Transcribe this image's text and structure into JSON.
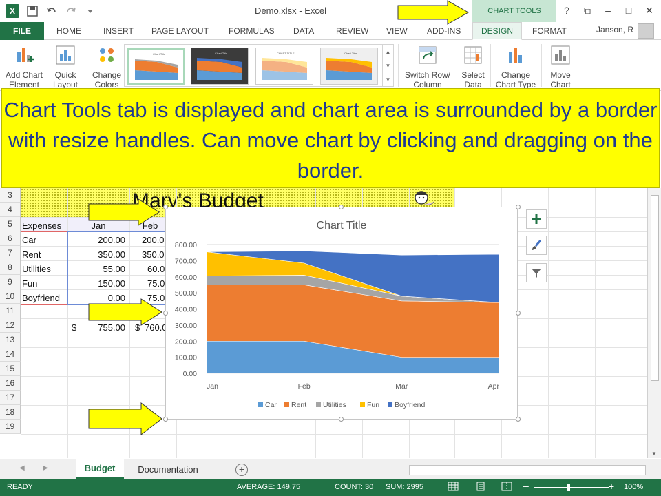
{
  "titlebar": {
    "app_icon": "X",
    "doc_title": "Demo.xlsx - Excel",
    "context_group": "CHART TOOLS",
    "window_controls": [
      "?",
      "⧉",
      "–",
      "□",
      "✕"
    ]
  },
  "tabs": {
    "file": "FILE",
    "home": "HOME",
    "insert": "INSERT",
    "page_layout": "PAGE LAYOUT",
    "formulas": "FORMULAS",
    "data": "DATA",
    "review": "REVIEW",
    "view": "VIEW",
    "addins": "ADD-INS",
    "design": "DESIGN",
    "format": "FORMAT",
    "user": "Janson, R"
  },
  "ribbon": {
    "add_chart_element": "Add Chart Element",
    "quick_layout": "Quick Layout",
    "change_colors": "Change Colors",
    "switch_row_column": "Switch Row/ Column",
    "select_data": "Select Data",
    "change_chart_type": "Change Chart Type",
    "move_chart": "Move Chart",
    "style_thumbs": [
      "Chart Title",
      "Chart Title",
      "CHART TITLE",
      "Chart Title"
    ]
  },
  "callout": {
    "text": "Chart Tools tab is displayed and chart area is surrounded by a border with resize handles.  Can move chart by clicking and dragging on the border."
  },
  "sheet": {
    "row_numbers": [
      "3",
      "4",
      "5",
      "6",
      "7",
      "8",
      "9",
      "10",
      "11",
      "12",
      "13",
      "14",
      "15",
      "16",
      "17",
      "18",
      "19"
    ],
    "title": "Mary's Budget",
    "header": {
      "expenses": "Expenses",
      "jan": "Jan",
      "feb": "Feb"
    },
    "rows": [
      {
        "label": "Car",
        "jan": "200.00",
        "feb": "200.0"
      },
      {
        "label": "Rent",
        "jan": "350.00",
        "feb": "350.0"
      },
      {
        "label": "Utilities",
        "jan": "55.00",
        "feb": "60.0"
      },
      {
        "label": "Fun",
        "jan": "150.00",
        "feb": "75.0"
      },
      {
        "label": "Boyfriend",
        "jan": "0.00",
        "feb": "75.0"
      }
    ],
    "totals": {
      "currency": "$",
      "jan": "755.00",
      "feb_currency": "$",
      "feb": "760.0"
    }
  },
  "chart_data": {
    "type": "area",
    "stacked": true,
    "title": "Chart Title",
    "categories": [
      "Jan",
      "Feb",
      "Mar",
      "Apr"
    ],
    "ylim": [
      0,
      800
    ],
    "yticks": [
      "800.00",
      "700.00",
      "600.00",
      "500.00",
      "400.00",
      "300.00",
      "200.00",
      "100.00",
      "0.00"
    ],
    "grid": true,
    "legend_position": "bottom",
    "series": [
      {
        "name": "Car",
        "color": "#5b9bd5",
        "values": [
          200,
          200,
          100,
          100
        ]
      },
      {
        "name": "Rent",
        "color": "#ed7d31",
        "values": [
          350,
          350,
          350,
          340
        ]
      },
      {
        "name": "Utilities",
        "color": "#a5a5a5",
        "values": [
          55,
          60,
          30,
          0
        ]
      },
      {
        "name": "Fun",
        "color": "#ffc000",
        "values": [
          150,
          75,
          0,
          0
        ]
      },
      {
        "name": "Boyfriend",
        "color": "#4472c4",
        "values": [
          0,
          75,
          255,
          300
        ]
      }
    ]
  },
  "sheet_tabs": {
    "active": "Budget",
    "other": "Documentation",
    "add": "+"
  },
  "status": {
    "ready": "READY",
    "average": "AVERAGE: 149.75",
    "count": "COUNT: 30",
    "sum": "SUM: 2995",
    "zoom": "100%"
  },
  "colors": {
    "excel_green": "#217346",
    "callout_yellow": "#ffff00",
    "callout_text": "#1f3a93"
  }
}
